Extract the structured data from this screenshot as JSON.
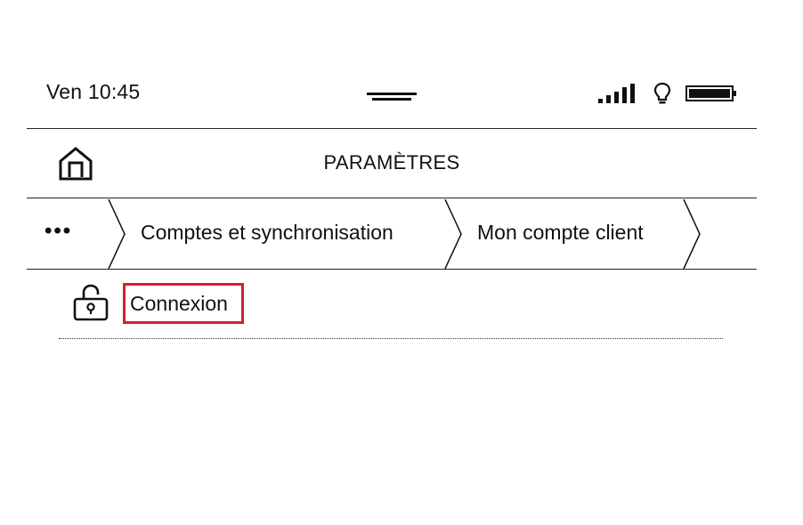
{
  "status_bar": {
    "time": "Ven 10:45",
    "icons": [
      "signal-icon",
      "lightbulb-icon",
      "battery-icon"
    ]
  },
  "header": {
    "title": "PARAMÈTRES",
    "home_icon": "home-icon"
  },
  "breadcrumb": {
    "more": "•••",
    "items": [
      {
        "label": "Comptes et synchronisation"
      },
      {
        "label": "Mon compte client"
      }
    ]
  },
  "list": {
    "items": [
      {
        "label": "Connexion",
        "icon": "unlocked-padlock-icon",
        "highlighted": true
      }
    ]
  },
  "colors": {
    "text": "#111111",
    "divider": "#222222",
    "highlight": "#d0222e",
    "background": "#ffffff"
  }
}
